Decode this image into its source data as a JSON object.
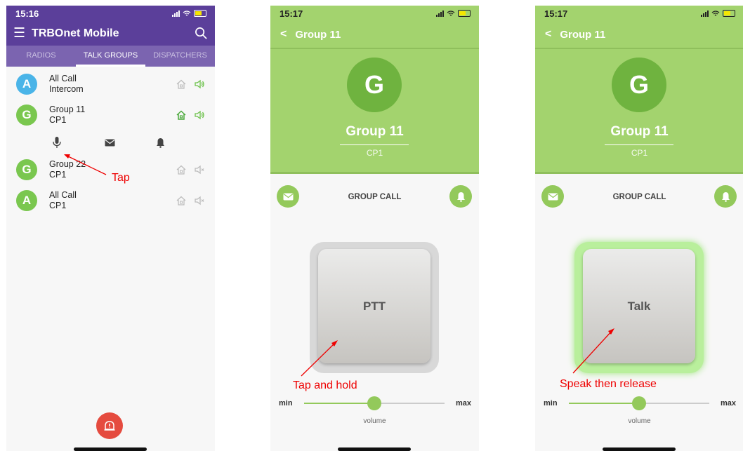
{
  "screen1": {
    "status_time": "15:16",
    "app_title": "TRBOnet Mobile",
    "tabs": [
      {
        "label": "RADIOS",
        "active": false
      },
      {
        "label": "TALK GROUPS",
        "active": true
      },
      {
        "label": "DISPATCHERS",
        "active": false
      }
    ],
    "items": [
      {
        "avatar": "A",
        "line1": "All Call",
        "line2": "Intercom",
        "avatar_color": "#4ab4e8",
        "home_active": false,
        "speaker_on": true
      },
      {
        "avatar": "G",
        "line1": "Group 11",
        "line2": "CP1",
        "avatar_color": "#7ac74f",
        "home_active": true,
        "speaker_on": true
      },
      {
        "avatar": "G",
        "line1": "Group 22",
        "line2": "CP1",
        "avatar_color": "#7ac74f",
        "home_active": false,
        "speaker_on": false
      },
      {
        "avatar": "A",
        "line1": "All Call",
        "line2": "CP1",
        "avatar_color": "#7ac74f",
        "home_active": false,
        "speaker_on": false
      }
    ],
    "row_actions": [
      "microphone-icon",
      "envelope-icon",
      "bell-icon"
    ],
    "annotation": "Tap"
  },
  "screen2": {
    "status_time": "15:17",
    "header_title": "Group 11",
    "avatar": "G",
    "group_name": "Group 11",
    "group_sub": "CP1",
    "call_title": "GROUP CALL",
    "button_label": "PTT",
    "annotation": "Tap and hold",
    "volume_min": "min",
    "volume_max": "max",
    "volume_label": "volume",
    "volume_level": 0.5
  },
  "screen3": {
    "status_time": "15:17",
    "header_title": "Group 11",
    "avatar": "G",
    "group_name": "Group 11",
    "group_sub": "CP1",
    "call_title": "GROUP CALL",
    "button_label": "Talk",
    "annotation": "Speak then release",
    "volume_min": "min",
    "volume_max": "max",
    "volume_label": "volume",
    "volume_level": 0.5
  },
  "colors": {
    "purple": "#5b3f9a",
    "green": "#a3d36e",
    "accent_green": "#93c95b",
    "alarm_red": "#e54b3f",
    "annotation_red": "#ee0000"
  }
}
